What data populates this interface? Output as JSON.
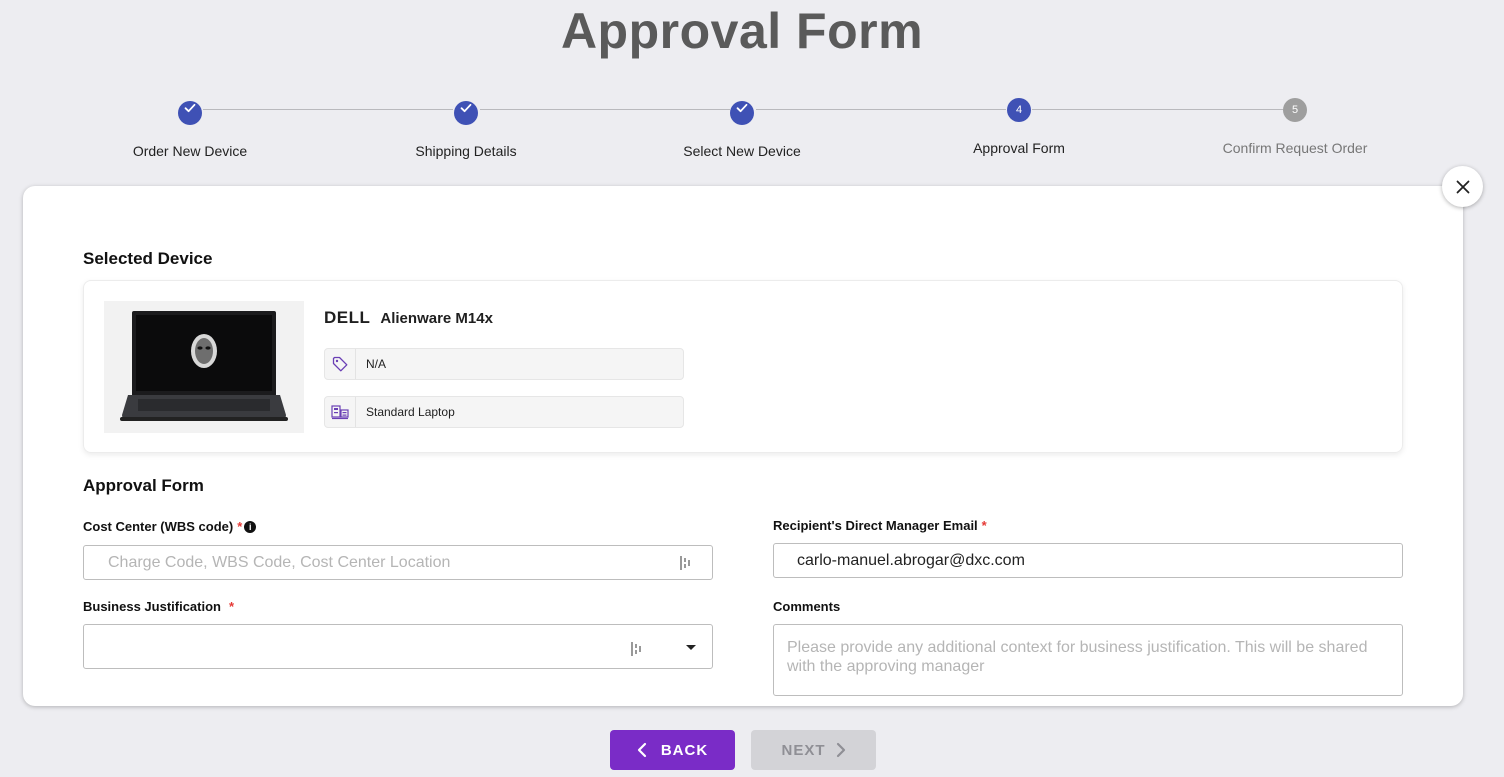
{
  "page": {
    "title": "Approval Form"
  },
  "stepper": {
    "steps": [
      {
        "label": "Order New Device",
        "status": "done"
      },
      {
        "label": "Shipping Details",
        "status": "done"
      },
      {
        "label": "Select New Device",
        "status": "done"
      },
      {
        "label": "Approval Form",
        "status": "active",
        "number": "4"
      },
      {
        "label": "Confirm Request Order",
        "status": "todo",
        "number": "5"
      }
    ]
  },
  "selected_device": {
    "heading": "Selected Device",
    "brand": "DELL",
    "model": "Alienware M14x",
    "price_tag": "N/A",
    "category": "Standard Laptop",
    "icons": {
      "price": "tag-icon",
      "category": "device-category-icon",
      "image": "laptop-image"
    }
  },
  "approval_form": {
    "heading": "Approval Form",
    "cost_center": {
      "label": "Cost Center (WBS code)",
      "required_mark": "*",
      "info_icon": "i",
      "placeholder": "Charge Code, WBS Code, Cost Center Location",
      "value": ""
    },
    "manager_email": {
      "label": "Recipient's Direct Manager Email",
      "required_mark": "*",
      "value": "carlo-manuel.abrogar@dxc.com"
    },
    "business_justification": {
      "label": "Business Justification",
      "required_mark": "*",
      "value": ""
    },
    "comments": {
      "label": "Comments",
      "placeholder": "Please provide any additional context for business justification. This will be shared with the approving manager"
    }
  },
  "buttons": {
    "back": "BACK",
    "next": "NEXT"
  },
  "colors": {
    "step_active": "#3f51b5",
    "step_todo": "#9e9e9e",
    "primary_button": "#7a2cc7",
    "disabled_button": "#d3d3d7",
    "required": "#e53935",
    "icon_accent": "#6a3fb5"
  }
}
